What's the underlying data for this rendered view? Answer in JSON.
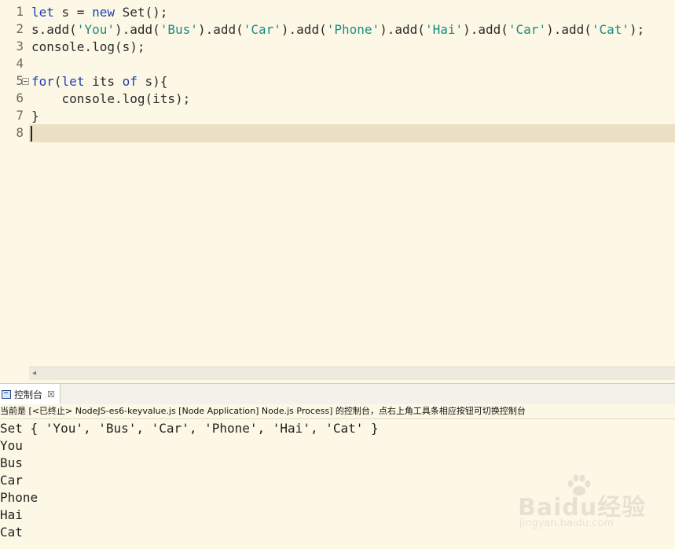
{
  "editor": {
    "line_numbers": [
      "1",
      "2",
      "3",
      "4",
      "5",
      "6",
      "7",
      "8"
    ],
    "lines": [
      [
        {
          "t": "let",
          "c": "kw"
        },
        {
          "t": " s = ",
          "c": ""
        },
        {
          "t": "new",
          "c": "kw"
        },
        {
          "t": " Set();",
          "c": ""
        }
      ],
      [
        {
          "t": "s.add(",
          "c": ""
        },
        {
          "t": "'You'",
          "c": "str"
        },
        {
          "t": ").add(",
          "c": ""
        },
        {
          "t": "'Bus'",
          "c": "str"
        },
        {
          "t": ").add(",
          "c": ""
        },
        {
          "t": "'Car'",
          "c": "str"
        },
        {
          "t": ").add(",
          "c": ""
        },
        {
          "t": "'Phone'",
          "c": "str"
        },
        {
          "t": ").add(",
          "c": ""
        },
        {
          "t": "'Hai'",
          "c": "str"
        },
        {
          "t": ").add(",
          "c": ""
        },
        {
          "t": "'Car'",
          "c": "str"
        },
        {
          "t": ").add(",
          "c": ""
        },
        {
          "t": "'Cat'",
          "c": "str"
        },
        {
          "t": ");",
          "c": ""
        }
      ],
      [
        {
          "t": "console.log(s);",
          "c": ""
        }
      ],
      [],
      [
        {
          "t": "for",
          "c": "kw"
        },
        {
          "t": "(",
          "c": ""
        },
        {
          "t": "let",
          "c": "kw"
        },
        {
          "t": " its ",
          "c": ""
        },
        {
          "t": "of",
          "c": "kw"
        },
        {
          "t": " s){",
          "c": ""
        }
      ],
      [
        {
          "t": "    console.log(its);",
          "c": ""
        }
      ],
      [
        {
          "t": "}",
          "c": ""
        }
      ],
      []
    ]
  },
  "console": {
    "tab_label": "控制台",
    "tab_close": "☒",
    "description": "当前是 [<已终止> NodeJS-es6-keyvalue.js [Node Application] Node.js Process] 的控制台，点右上角工具条相应按钮可切换控制台",
    "output": [
      "Set { 'You', 'Bus', 'Car', 'Phone', 'Hai', 'Cat' }",
      "You",
      "Bus",
      "Car",
      "Phone",
      "Hai",
      "Cat"
    ]
  },
  "watermark": {
    "main": "Baidu经验",
    "sub": "jingyan.baidu.com"
  },
  "colors": {
    "keyword": "#1f3fb5",
    "string": "#1a8a82",
    "editor_bg": "#fdf8e6",
    "current_line": "#ece0c4"
  }
}
